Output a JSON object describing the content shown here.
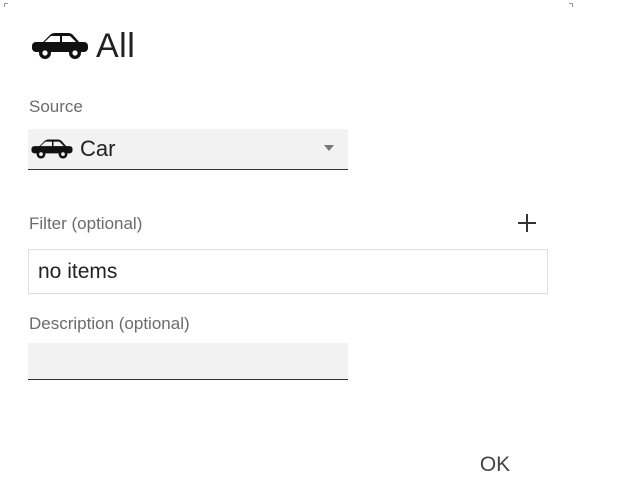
{
  "dialog": {
    "title": "All",
    "title_icon": "car-icon"
  },
  "source": {
    "label": "Source",
    "selected_value": "Car",
    "selected_icon": "car-icon"
  },
  "filter": {
    "label": "Filter (optional)",
    "add_icon": "plus-icon",
    "value": "no items"
  },
  "description": {
    "label": "Description (optional)",
    "value": ""
  },
  "actions": {
    "ok_label": "OK"
  }
}
